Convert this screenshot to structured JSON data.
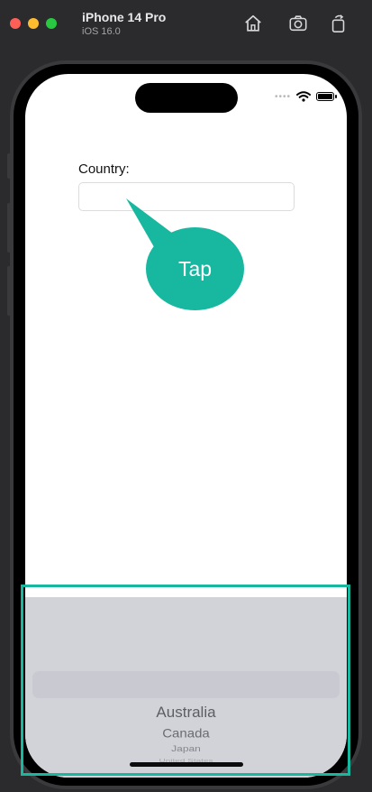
{
  "simulator": {
    "device_name": "iPhone 14 Pro",
    "os_version": "iOS 16.0",
    "toolbar": [
      "home-icon",
      "screenshot-icon",
      "rotate-icon"
    ]
  },
  "form": {
    "country_label": "Country:",
    "country_value": ""
  },
  "picker": {
    "options": [
      "Australia",
      "Canada",
      "Japan",
      "United States"
    ]
  },
  "hint": {
    "bubble_text": "Tap",
    "accent_color": "#17b7a0"
  }
}
